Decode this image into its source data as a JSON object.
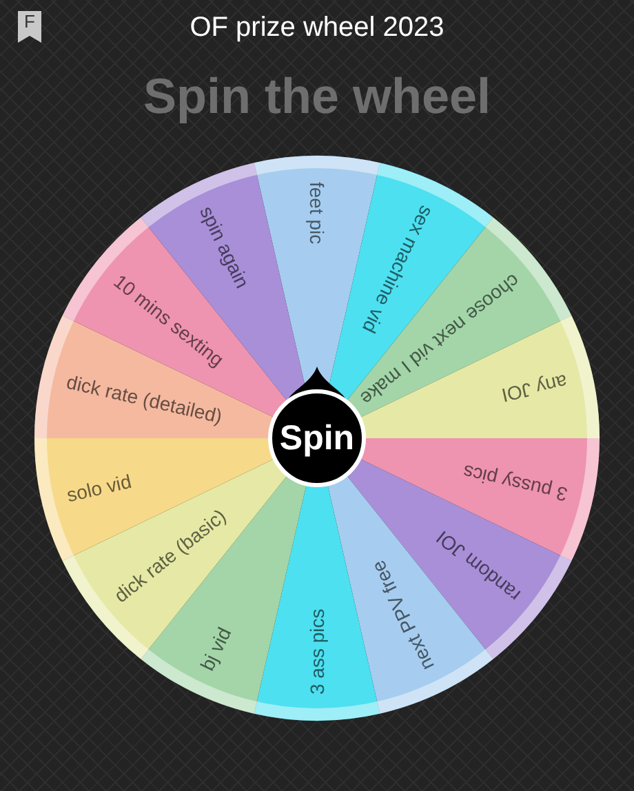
{
  "header": {
    "badge_letter": "F",
    "title": "OF prize wheel 2023"
  },
  "heading": "Spin the wheel",
  "wheel": {
    "center_button": "Spin",
    "segments": [
      {
        "label": "feet pic",
        "color": "#a6cdef"
      },
      {
        "label": "sex machine vid",
        "color": "#4de0f0"
      },
      {
        "label": "choose next vid I make",
        "color": "#a3d5a8"
      },
      {
        "label": "any JOI",
        "color": "#e5e9a5"
      },
      {
        "label": "3 pussy pics",
        "color": "#ee94b0"
      },
      {
        "label": "random JOI",
        "color": "#a98fd8"
      },
      {
        "label": "next PPV free",
        "color": "#a6cdef"
      },
      {
        "label": "3 ass pics",
        "color": "#4de0f0"
      },
      {
        "label": "bj vid",
        "color": "#a3d5a8"
      },
      {
        "label": "dick rate (basic)",
        "color": "#e5e9a5"
      },
      {
        "label": "solo vid",
        "color": "#f7d98a"
      },
      {
        "label": "dick rate (detailed)",
        "color": "#f5b9a0"
      },
      {
        "label": "10 mins sexting",
        "color": "#ee94b0"
      },
      {
        "label": "spin again",
        "color": "#a98fd8"
      }
    ]
  }
}
